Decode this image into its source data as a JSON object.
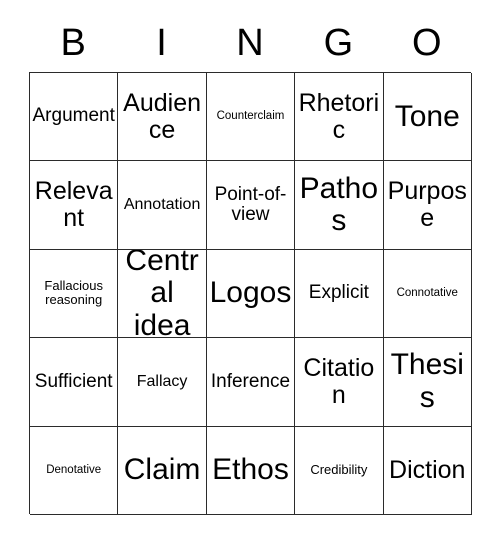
{
  "card": {
    "header_letters": [
      "B",
      "I",
      "N",
      "G",
      "O"
    ],
    "columns": 5,
    "rows": 5,
    "border_color": "#2b2b2b",
    "background_color": "#ffffff",
    "text_color": "#000000"
  },
  "grid": {
    "cells": [
      {
        "label": "Argument",
        "size": "md",
        "row": 1,
        "col": 1
      },
      {
        "label": "Audience",
        "size": "lg",
        "row": 1,
        "col": 2
      },
      {
        "label": "Counterclaim",
        "size": "xxs",
        "row": 1,
        "col": 3
      },
      {
        "label": "Rhetoric",
        "size": "lg",
        "row": 1,
        "col": 4
      },
      {
        "label": "Tone",
        "size": "xl",
        "row": 1,
        "col": 5
      },
      {
        "label": "Relevant",
        "size": "lg",
        "row": 2,
        "col": 1
      },
      {
        "label": "Annotation",
        "size": "sm",
        "row": 2,
        "col": 2
      },
      {
        "label": "Point-of-view",
        "size": "md",
        "row": 2,
        "col": 3
      },
      {
        "label": "Pathos",
        "size": "xl",
        "row": 2,
        "col": 4
      },
      {
        "label": "Purpose",
        "size": "lg",
        "row": 2,
        "col": 5
      },
      {
        "label": "Fallacious reasoning",
        "size": "xs",
        "row": 3,
        "col": 1
      },
      {
        "label": "Central idea",
        "size": "xl",
        "row": 3,
        "col": 2
      },
      {
        "label": "Logos",
        "size": "xl",
        "row": 3,
        "col": 3
      },
      {
        "label": "Explicit",
        "size": "md",
        "row": 3,
        "col": 4
      },
      {
        "label": "Connotative",
        "size": "xxs",
        "row": 3,
        "col": 5
      },
      {
        "label": "Sufficient",
        "size": "md",
        "row": 4,
        "col": 1
      },
      {
        "label": "Fallacy",
        "size": "sm",
        "row": 4,
        "col": 2
      },
      {
        "label": "Inference",
        "size": "md",
        "row": 4,
        "col": 3
      },
      {
        "label": "Citation",
        "size": "lg",
        "row": 4,
        "col": 4
      },
      {
        "label": "Thesis",
        "size": "xl",
        "row": 4,
        "col": 5
      },
      {
        "label": "Denotative",
        "size": "xxs",
        "row": 5,
        "col": 1
      },
      {
        "label": "Claim",
        "size": "xl",
        "row": 5,
        "col": 2
      },
      {
        "label": "Ethos",
        "size": "xl",
        "row": 5,
        "col": 3
      },
      {
        "label": "Credibility",
        "size": "xs",
        "row": 5,
        "col": 4
      },
      {
        "label": "Diction",
        "size": "lg",
        "row": 5,
        "col": 5
      }
    ]
  }
}
